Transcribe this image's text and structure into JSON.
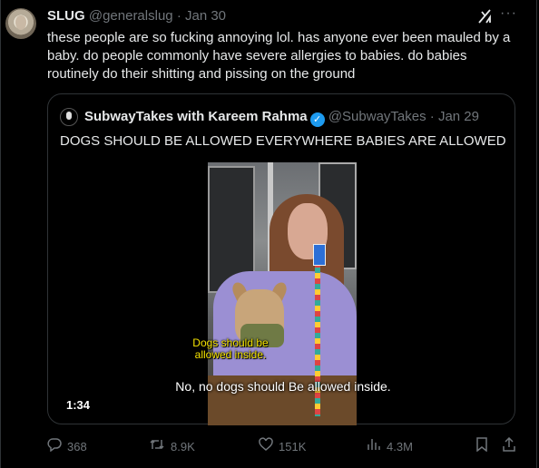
{
  "tweet": {
    "display_name": "SLUG",
    "handle": "@generalslug",
    "separator": "·",
    "date": "Jan 30",
    "text": "these people are so fucking annoying lol. has anyone ever been mauled by a baby. do people commonly have severe allergies to babies. do babies routinely do their shitting and pissing on the ground",
    "grok_icon": "grok-icon",
    "more_label": "···"
  },
  "quote": {
    "display_name": "SubwayTakes with Kareem Rahma",
    "verified_mark": "✓",
    "handle": "@SubwayTakes",
    "separator": "·",
    "date": "Jan 29",
    "text": "DOGS SHOULD BE ALLOWED EVERYWHERE BABIES ARE ALLOWED",
    "video": {
      "caption_yellow": "Dogs should be allowed inside.",
      "caption_white": "No, no dogs should Be allowed inside.",
      "duration": "1:34"
    }
  },
  "actions": {
    "replies": "368",
    "retweets": "8.9K",
    "likes": "151K",
    "views": "4.3M"
  },
  "icons": {
    "reply": "reply-icon",
    "retweet": "retweet-icon",
    "like": "heart-icon",
    "views": "views-icon",
    "bookmark": "bookmark-icon",
    "share": "share-icon"
  },
  "colors": {
    "background": "#000000",
    "text": "#e7e9ea",
    "muted": "#71767b",
    "verified": "#1d9bf0",
    "border": "#2f3336",
    "caption_yellow": "#f5e300"
  }
}
